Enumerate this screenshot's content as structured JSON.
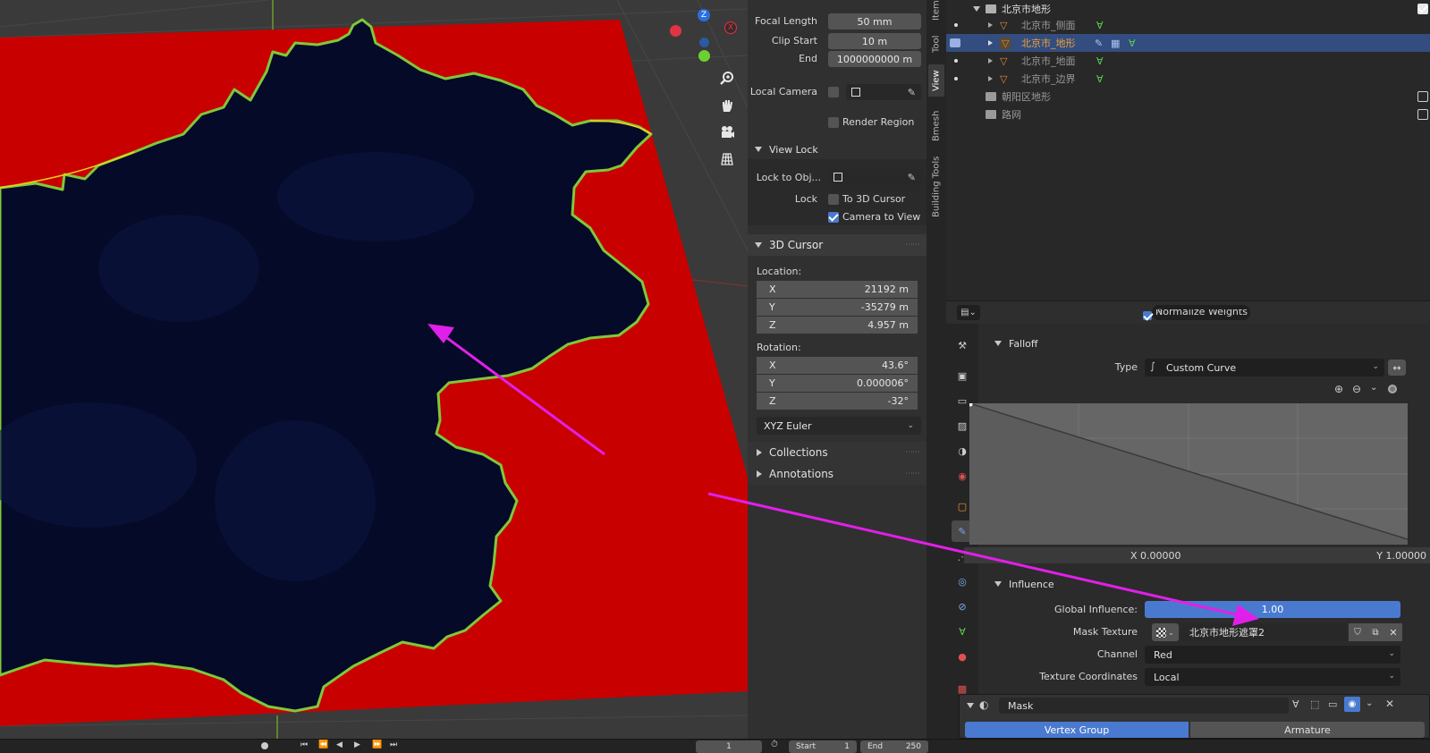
{
  "npanel": {
    "focal_length": {
      "label": "Focal Length",
      "value": "50 mm"
    },
    "clip_start": {
      "label": "Clip Start",
      "value": "10 m"
    },
    "clip_end": {
      "label": "End",
      "value": "1000000000 m"
    },
    "local_camera": {
      "label": "Local Camera"
    },
    "render_region": {
      "label": "Render Region"
    },
    "view_lock": {
      "title": "View Lock",
      "lock_to_object": "Lock to Obj...",
      "lock": "Lock",
      "to_3d_cursor": "To 3D Cursor",
      "camera_to_view": "Camera to View"
    },
    "cursor": {
      "title": "3D Cursor",
      "location_label": "Location:",
      "location": [
        {
          "axis": "X",
          "value": "21192 m"
        },
        {
          "axis": "Y",
          "value": "-35279 m"
        },
        {
          "axis": "Z",
          "value": "4.957 m"
        }
      ],
      "rotation_label": "Rotation:",
      "rotation": [
        {
          "axis": "X",
          "value": "43.6°"
        },
        {
          "axis": "Y",
          "value": "0.000006°"
        },
        {
          "axis": "Z",
          "value": "-32°"
        }
      ],
      "rotation_mode": "XYZ Euler"
    },
    "collections": "Collections",
    "annotations": "Annotations"
  },
  "side_tabs": [
    "Item",
    "Tool",
    "View",
    "Bmesh",
    "Building Tools"
  ],
  "outliner": {
    "collection": "北京市地形",
    "items": [
      {
        "name": "北京市_侧面",
        "selected": false
      },
      {
        "name": "北京市_地形",
        "selected": true
      },
      {
        "name": "北京市_地面",
        "selected": false
      },
      {
        "name": "北京市_边界",
        "selected": false
      }
    ],
    "other_collections": [
      "朝阳区地形",
      "路网"
    ]
  },
  "props": {
    "truncated_option": "Normalize Weights",
    "falloff": {
      "title": "Falloff",
      "type_label": "Type",
      "type_value": "Custom Curve",
      "x_readout": "X 0.00000",
      "y_readout": "Y 1.00000"
    },
    "influence": {
      "title": "Influence",
      "global_label": "Global Influence:",
      "global_value": "1.00",
      "mask_texture_label": "Mask Texture",
      "mask_texture_value": "北京市地形遮罩2",
      "channel_label": "Channel",
      "channel_value": "Red",
      "texcoords_label": "Texture Coordinates",
      "texcoords_value": "Local"
    },
    "mask_modifier": {
      "name": "Mask",
      "mode_a": "Vertex Group",
      "mode_b": "Armature"
    }
  },
  "timeline": {
    "frame": "1",
    "start_label": "Start",
    "start_value": "1",
    "end_label": "End",
    "end_value": "250"
  },
  "colors": {
    "terrain_red": "#c80000",
    "terrain_navy": "#050a28",
    "annotation_arrow": "#e020e8",
    "accent_blue": "#4a7ad0",
    "selection": "#334d80"
  }
}
